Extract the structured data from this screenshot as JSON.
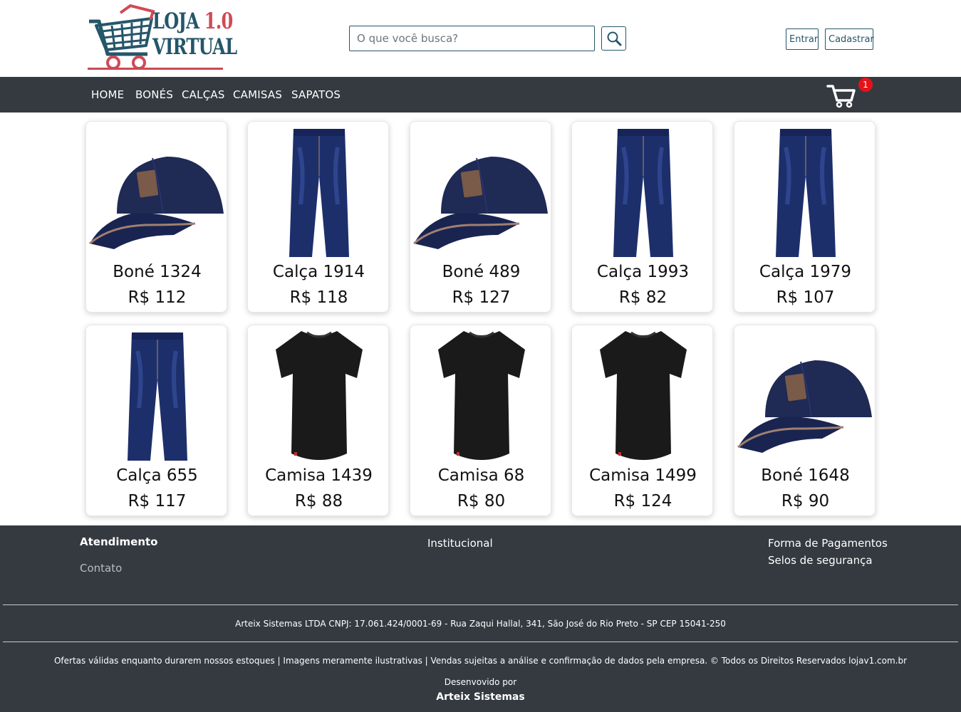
{
  "logo": {
    "line1": "LOJA",
    "version": "1.0",
    "line2": "VIRTUAL"
  },
  "search": {
    "placeholder": "O que você busca?",
    "value": ""
  },
  "auth": {
    "login_label": "Entrar",
    "register_label": "Cadastrar"
  },
  "nav": {
    "items": [
      "HOME",
      "BONÉS",
      "CALÇAS",
      "CAMISAS",
      "SAPATOS"
    ],
    "cart_count": "1"
  },
  "products": [
    {
      "name": "Boné 1324",
      "price": "R$ 112",
      "icon": "cap"
    },
    {
      "name": "Calça 1914",
      "price": "R$ 118",
      "icon": "jeans"
    },
    {
      "name": "Boné 489",
      "price": "R$ 127",
      "icon": "cap"
    },
    {
      "name": "Calça 1993",
      "price": "R$ 82",
      "icon": "jeans"
    },
    {
      "name": "Calça 1979",
      "price": "R$ 107",
      "icon": "jeans"
    },
    {
      "name": "Calça 655",
      "price": "R$ 117",
      "icon": "jeans"
    },
    {
      "name": "Camisa 1439",
      "price": "R$ 88",
      "icon": "tshirt"
    },
    {
      "name": "Camisa 68",
      "price": "R$ 80",
      "icon": "tshirt"
    },
    {
      "name": "Camisa 1499",
      "price": "R$ 124",
      "icon": "tshirt"
    },
    {
      "name": "Boné 1648",
      "price": "R$ 90",
      "icon": "cap"
    }
  ],
  "footer": {
    "atendimento_title": "Atendimento",
    "contato": "Contato",
    "institucional": "Institucional",
    "pagamentos": "Forma de Pagamentos",
    "selos": "Selos de segurança",
    "company": "Arteix Sistemas LTDA CNPJ: 17.061.424/0001-69 - Rua Zaqui Hallal, 341, São José do Rio Preto - SP CEP 15041-250",
    "offers": "Ofertas válidas enquanto durarem nossos estoques | Imagens meramente ilustrativas | Vendas sujeitas a análise e confirmação de dados pela empresa. © Todos os Direitos Reservados lojav1.com.br",
    "developed_by": "Desenvovido por",
    "developer": "Arteix Sistemas"
  },
  "colors": {
    "brand": "#25566a",
    "accent": "#d04a55",
    "dark": "#343a40",
    "badge": "#e3131b"
  }
}
